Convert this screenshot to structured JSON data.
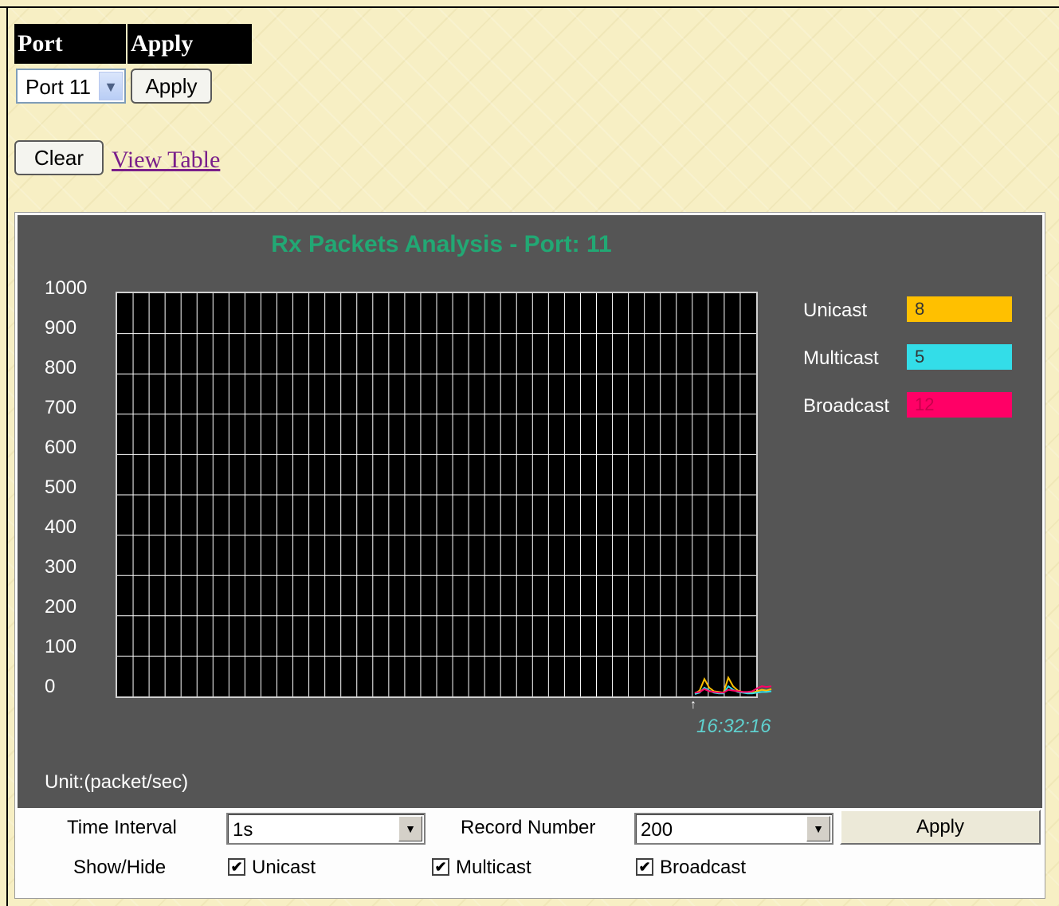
{
  "port_section": {
    "port_header": "Port",
    "apply_header": "Apply",
    "selected_port": "Port 11",
    "apply_label": "Apply"
  },
  "actions": {
    "clear_label": "Clear",
    "view_table_label": "View Table"
  },
  "chart_data": {
    "type": "line",
    "title": "Rx Packets Analysis - Port: 11",
    "ylim": [
      0,
      1000
    ],
    "y_ticks": [
      "1000",
      "900",
      "800",
      "700",
      "600",
      "500",
      "400",
      "300",
      "200",
      "100",
      "0"
    ],
    "unit_label": "Unit:(packet/sec)",
    "time_label": "16:32:16",
    "legend": [
      {
        "name": "Unicast",
        "value": "8",
        "color": "#ffc000"
      },
      {
        "name": "Multicast",
        "value": "5",
        "color": "#33dde8"
      },
      {
        "name": "Broadcast",
        "value": "12",
        "color": "#ff0066"
      }
    ],
    "series": [
      {
        "name": "Unicast",
        "color": "#ffc000",
        "values": [
          2,
          6,
          22,
          10,
          5,
          4,
          3,
          24,
          12,
          6,
          4,
          3,
          3,
          5,
          7,
          6,
          8
        ]
      },
      {
        "name": "Multicast",
        "color": "#33dde8",
        "values": [
          1,
          3,
          10,
          6,
          3,
          2,
          2,
          12,
          7,
          4,
          3,
          2,
          2,
          3,
          4,
          4,
          5
        ]
      },
      {
        "name": "Broadcast",
        "color": "#ff0066",
        "values": [
          3,
          4,
          8,
          5,
          4,
          3,
          3,
          7,
          6,
          5,
          4,
          4,
          5,
          9,
          12,
          11,
          12
        ]
      }
    ]
  },
  "controls": {
    "time_interval_label": "Time Interval",
    "time_interval_value": "1s",
    "record_number_label": "Record Number",
    "record_number_value": "200",
    "apply_label": "Apply",
    "show_hide_label": "Show/Hide",
    "checkbox_mark": "✔",
    "unicast_label": "Unicast",
    "multicast_label": "Multicast",
    "broadcast_label": "Broadcast"
  }
}
